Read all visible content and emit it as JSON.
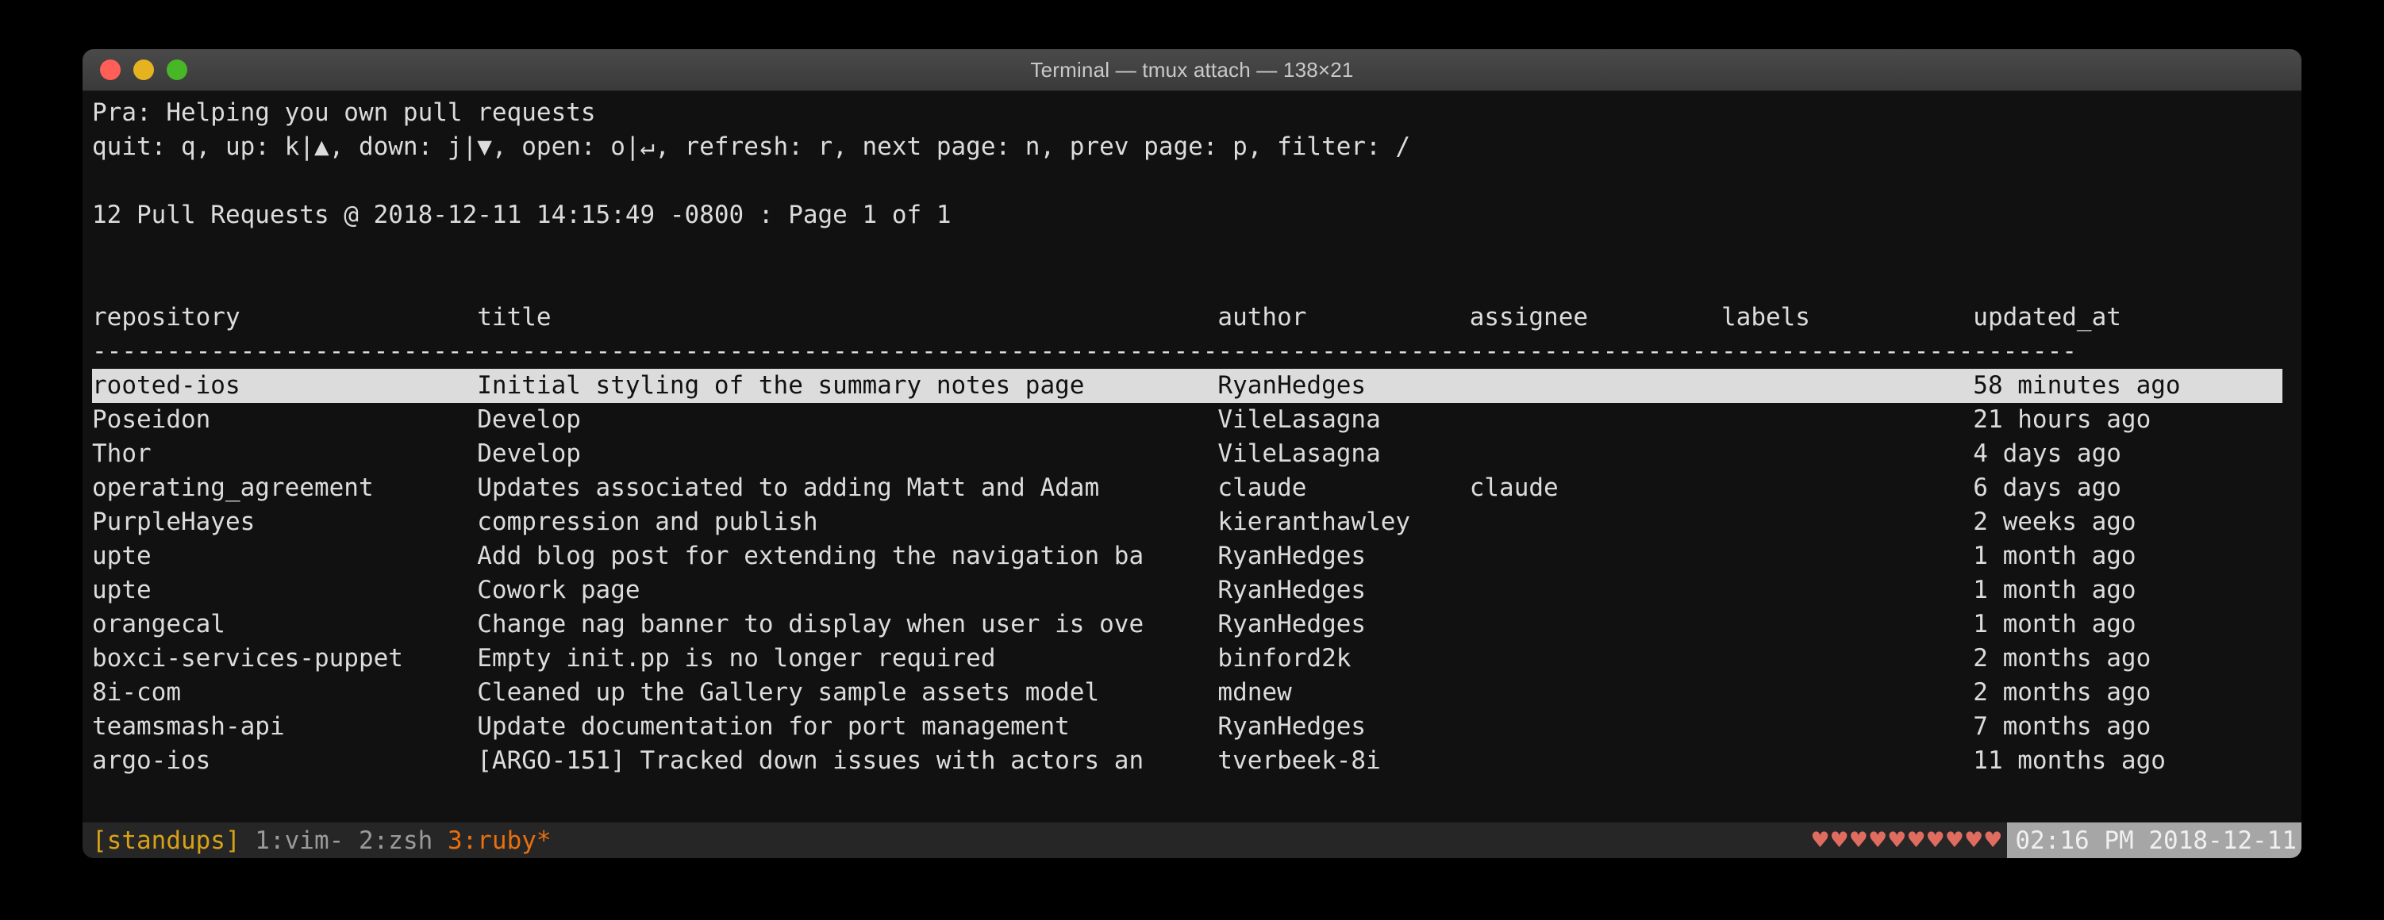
{
  "window": {
    "title": "Terminal — tmux attach — 138×21",
    "traffic_lights": [
      {
        "name": "close",
        "color": "#ff5f57"
      },
      {
        "name": "minimize",
        "color": "#e6b320"
      },
      {
        "name": "zoom",
        "color": "#47b627"
      }
    ]
  },
  "app": {
    "banner": "Pra: Helping you own pull requests",
    "keybindings": "quit: q, up: k|▲, down: j|▼, open: o|↵, refresh: r, next page: n, prev page: p, filter: /",
    "summary": "12 Pull Requests @ 2018-12-11 14:15:49 -0800 : Page 1 of 1",
    "pull_request_count": 12,
    "fetched_at": "2018-12-11 14:15:49 -0800",
    "page_current": 1,
    "page_total": 1,
    "separator": "--------------------------------------------------------------------------------------------------------------------------------------"
  },
  "table": {
    "columns": [
      {
        "key": "repository",
        "label": "repository",
        "col": 0,
        "width": 26
      },
      {
        "key": "title",
        "label": "title",
        "col": 26,
        "width": 50
      },
      {
        "key": "author",
        "label": "author",
        "col": 76,
        "width": 17
      },
      {
        "key": "assignee",
        "label": "assignee",
        "col": 93,
        "width": 17
      },
      {
        "key": "labels",
        "label": "labels",
        "col": 110,
        "width": 17
      },
      {
        "key": "updated_at",
        "label": "updated_at",
        "col": 127,
        "width": 18
      }
    ],
    "rows": [
      {
        "repository": "rooted-ios",
        "title": "Initial styling of the summary notes page",
        "author": "RyanHedges",
        "assignee": "",
        "labels": "",
        "updated_at": "58 minutes ago",
        "selected": true
      },
      {
        "repository": "Poseidon",
        "title": "Develop",
        "author": "VileLasagna",
        "assignee": "",
        "labels": "",
        "updated_at": "21 hours ago",
        "selected": false
      },
      {
        "repository": "Thor",
        "title": "Develop",
        "author": "VileLasagna",
        "assignee": "",
        "labels": "",
        "updated_at": "4 days ago",
        "selected": false
      },
      {
        "repository": "operating_agreement",
        "title": "Updates associated to adding Matt and Adam",
        "author": "claude",
        "assignee": "claude",
        "labels": "",
        "updated_at": "6 days ago",
        "selected": false
      },
      {
        "repository": "PurpleHayes",
        "title": "compression and publish",
        "author": "kieranthawley",
        "assignee": "",
        "labels": "",
        "updated_at": "2 weeks ago",
        "selected": false
      },
      {
        "repository": "upte",
        "title": "Add blog post for extending the navigation ba",
        "author": "RyanHedges",
        "assignee": "",
        "labels": "",
        "updated_at": "1 month ago",
        "selected": false
      },
      {
        "repository": "upte",
        "title": "Cowork page",
        "author": "RyanHedges",
        "assignee": "",
        "labels": "",
        "updated_at": "1 month ago",
        "selected": false
      },
      {
        "repository": "orangecal",
        "title": "Change nag banner to display when user is ove",
        "author": "RyanHedges",
        "assignee": "",
        "labels": "",
        "updated_at": "1 month ago",
        "selected": false
      },
      {
        "repository": "boxci-services-puppet",
        "title": "Empty init.pp is no longer required",
        "author": "binford2k",
        "assignee": "",
        "labels": "",
        "updated_at": "2 months ago",
        "selected": false
      },
      {
        "repository": "8i-com",
        "title": "Cleaned up the Gallery sample assets model",
        "author": "mdnew",
        "assignee": "",
        "labels": "",
        "updated_at": "2 months ago",
        "selected": false
      },
      {
        "repository": "teamsmash-api",
        "title": "Update documentation for port management",
        "author": "RyanHedges",
        "assignee": "",
        "labels": "",
        "updated_at": "7 months ago",
        "selected": false
      },
      {
        "repository": "argo-ios",
        "title": "[ARGO-151] Tracked down issues with actors an",
        "author": "tverbeek-8i",
        "assignee": "",
        "labels": "",
        "updated_at": "11 months ago",
        "selected": false
      }
    ]
  },
  "statusbar": {
    "session": "[standups]",
    "windows": [
      {
        "label": "1:vim-",
        "active": false
      },
      {
        "label": "2:zsh",
        "active": false
      },
      {
        "label": "3:ruby*",
        "active": true
      }
    ],
    "hearts": "♥♥♥♥♥♥♥♥♥♥",
    "heart_count": 10,
    "clock": "02:16 PM 2018-12-11",
    "colors": {
      "session": "#d9a216",
      "window_inactive": "#9a9a9a",
      "window_active": "#e8700f",
      "hearts": "#e06c60",
      "clock_bg": "#a6a6a6"
    }
  }
}
